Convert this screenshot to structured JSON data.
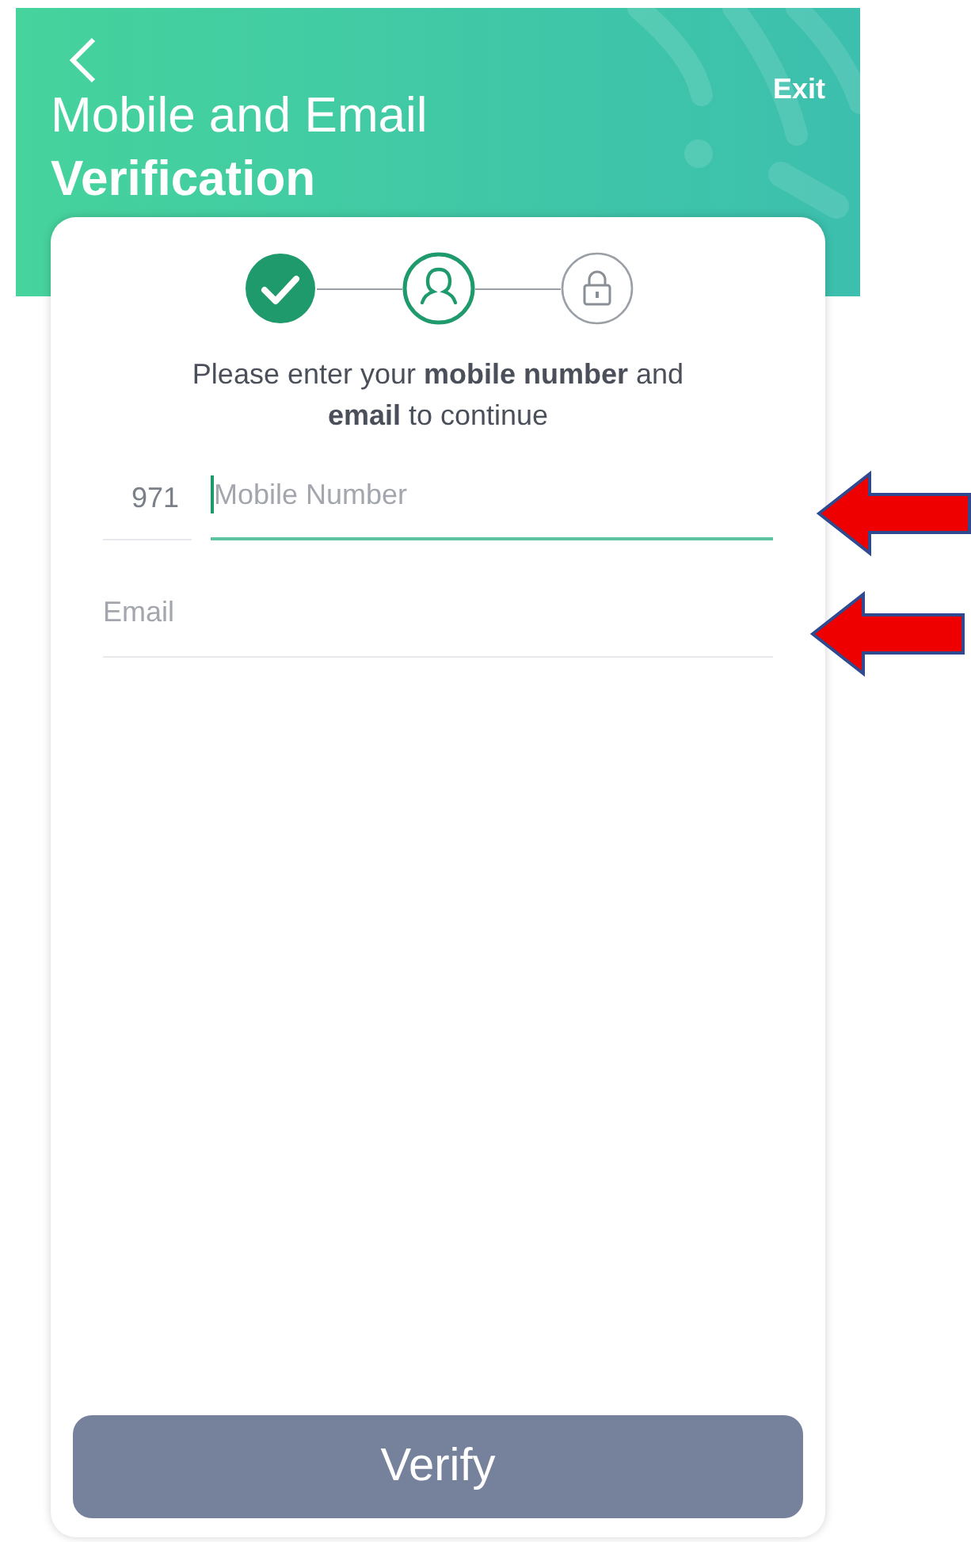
{
  "header": {
    "title": "Mobile and Email",
    "subtitle": "Verification",
    "exit": "Exit"
  },
  "steps": [
    {
      "kind": "done"
    },
    {
      "kind": "current"
    },
    {
      "kind": "pending"
    }
  ],
  "instruction": "Please enter your **mobile number** and **email** to continue",
  "fields": [
    {
      "kind": "phone",
      "prefix": "971",
      "placeholder": "Mobile Number",
      "focused": true
    },
    {
      "kind": "email",
      "placeholder": "Email",
      "focused": false
    }
  ],
  "button": {
    "label": "Verify",
    "disabled": true
  },
  "annotations": [
    {
      "kind": "arrow"
    },
    {
      "kind": "arrow"
    }
  ]
}
